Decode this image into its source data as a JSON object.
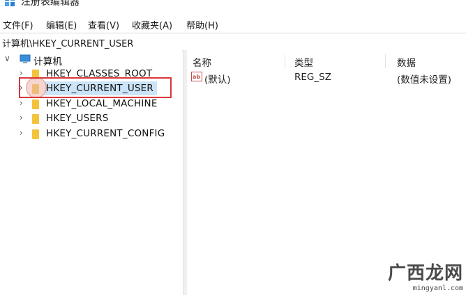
{
  "window": {
    "title": "注册表编辑器"
  },
  "menu": [
    "文件(F)",
    "编辑(E)",
    "查看(V)",
    "收藏夹(A)",
    "帮助(H)"
  ],
  "address": {
    "path": "计算机\\HKEY_CURRENT_USER"
  },
  "tree": {
    "root": "计算机",
    "children": [
      "HKEY_CLASSES_ROOT",
      "HKEY_CURRENT_USER",
      "HKEY_LOCAL_MACHINE",
      "HKEY_USERS",
      "HKEY_CURRENT_CONFIG"
    ],
    "selected": "HKEY_CURRENT_USER"
  },
  "list": {
    "columns": [
      "名称",
      "类型",
      "数据"
    ],
    "rows": [
      {
        "name": "(默认)",
        "type": "REG_SZ",
        "data": "(数值未设置)",
        "icon": "string-value-icon"
      }
    ]
  },
  "watermark": {
    "brand": "广西龙网",
    "url": "mingyanl.com"
  },
  "colors": {
    "selection": "#cce4f7",
    "highlight": "#d9373a",
    "folder": "#f2c33d"
  }
}
